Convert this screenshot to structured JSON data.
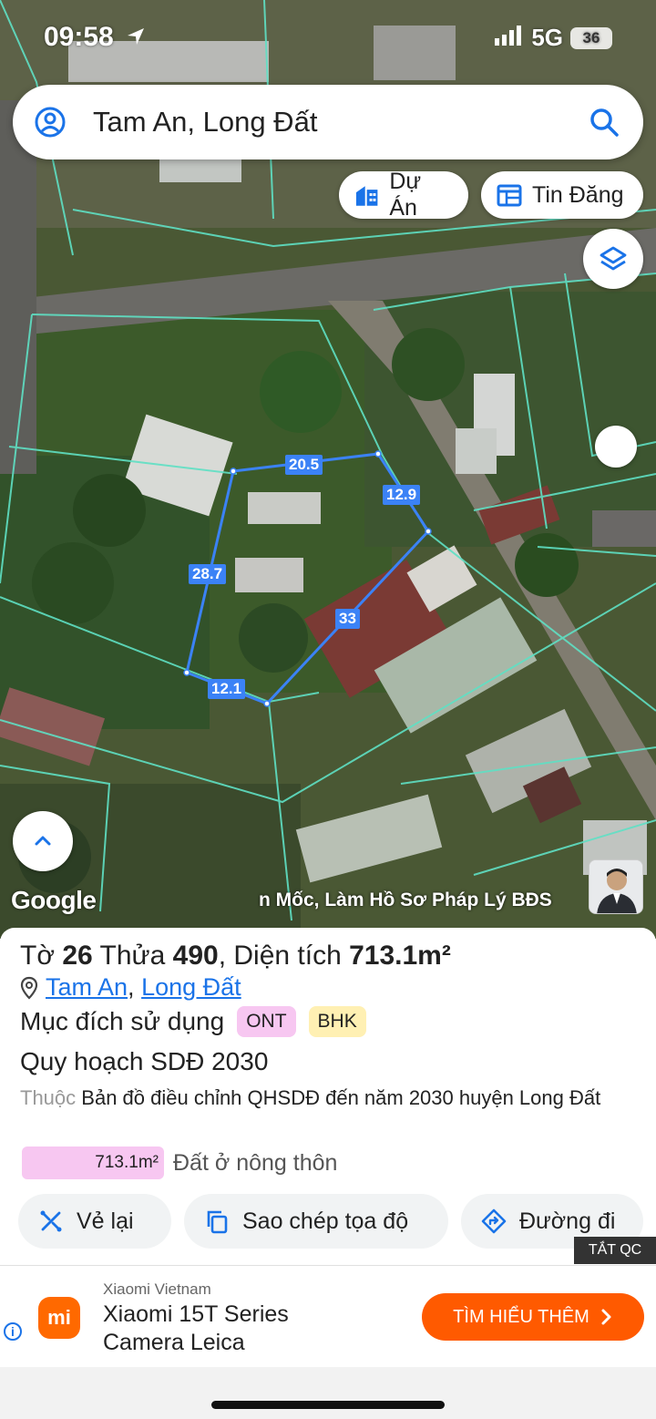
{
  "status": {
    "time": "09:58",
    "network": "5G",
    "battery": "36"
  },
  "search": {
    "query": "Tam An, Long Đất"
  },
  "chips": {
    "du_an": "Dự Án",
    "tin_dang": "Tin Đăng"
  },
  "map": {
    "google_logo": "Google",
    "watermark": "n Mốc, Làm Hồ Sơ Pháp Lý BĐS",
    "edges": [
      "20.5",
      "12.9",
      "33",
      "12.1",
      "28.7"
    ]
  },
  "parcel": {
    "title_prefix": "Tờ",
    "sheet": "26",
    "plot_label": "Thửa",
    "plot": "490",
    "area_label": ", Diện tích",
    "area": "713.1m²",
    "commune": "Tam An",
    "separator": ",",
    "district": "Long Đất",
    "purpose_label": "Mục đích sử dụng",
    "badges": [
      {
        "code": "ONT",
        "color": "#f7c7f1"
      },
      {
        "code": "BHK",
        "color": "#fff0b3"
      }
    ],
    "plan_title": "Quy hoạch SDĐ 2030",
    "plan_prefix": "Thuộc",
    "plan_desc": "Bản đồ điều chỉnh QHSDĐ đến năm 2030 huyện Long Đất",
    "breakdown_area": "713.1m²",
    "breakdown_label": "Đất ở nông thôn"
  },
  "actions": {
    "redraw": "Vẻ lại",
    "copy": "Sao chép tọa độ",
    "route": "Đường đi"
  },
  "ad": {
    "close_label": "TẮT QC",
    "brand": "Xiaomi Vietnam",
    "logo": "mi",
    "title_line1": "Xiaomi 15T Series",
    "title_line2": "Camera Leica",
    "cta": "TÌM HIỂU THÊM",
    "info": "i"
  }
}
